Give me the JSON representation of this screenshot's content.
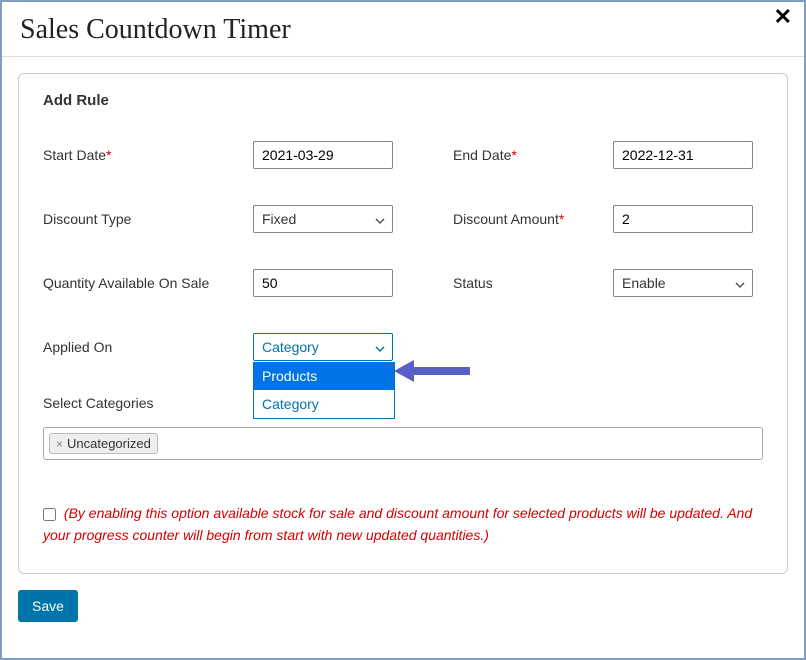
{
  "modal": {
    "title": "Sales Countdown Timer",
    "close_glyph": "✕"
  },
  "card": {
    "title": "Add Rule"
  },
  "form": {
    "start_date_label": "Start Date",
    "start_date_value": "2021-03-29",
    "end_date_label": "End Date",
    "end_date_value": "2022-12-31",
    "discount_type_label": "Discount Type",
    "discount_type_value": "Fixed",
    "discount_amount_label": "Discount Amount",
    "discount_amount_value": "2",
    "qty_label": "Quantity Available On Sale",
    "qty_value": "50",
    "status_label": "Status",
    "status_value": "Enable",
    "applied_on_label": "Applied On",
    "applied_on_value": "Category",
    "applied_on_options": {
      "opt0": "Products",
      "opt1": "Category"
    },
    "select_categories_label": "Select Categories",
    "category_token": "Uncategorized",
    "checkbox_note": "(By enabling this option available stock for sale and discount amount for selected products will be updated. And your progress counter will begin from start with new updated quantities.)"
  },
  "footer": {
    "save_label": "Save"
  }
}
